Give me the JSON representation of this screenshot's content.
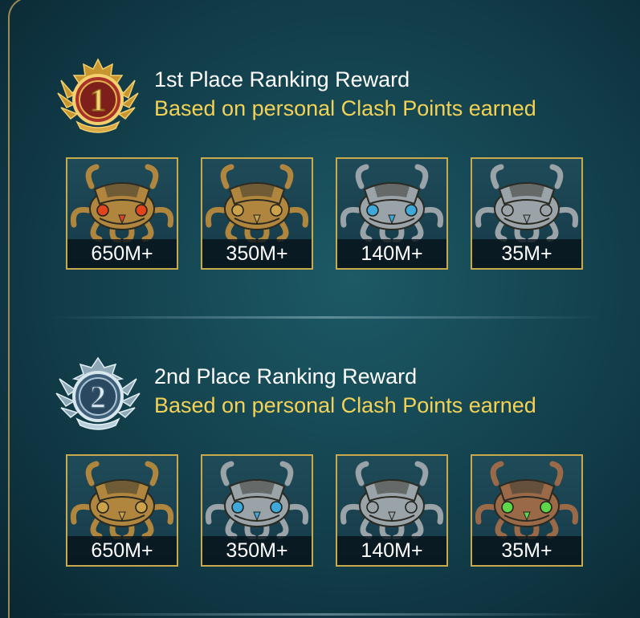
{
  "sections": [
    {
      "title": "1st Place Ranking Reward",
      "subtitle": "Based on personal Clash Points earned",
      "medal_icon": "gold-rank-1-medal-icon",
      "rewards": [
        {
          "label": "650M+",
          "chest_icon": "octopus-chest-icon",
          "tint": "#b0863e",
          "gem": "#e0451e"
        },
        {
          "label": "350M+",
          "chest_icon": "octopus-chest-icon",
          "tint": "#b0863e",
          "gem": "#c9a24a"
        },
        {
          "label": "140M+",
          "chest_icon": "octopus-chest-icon",
          "tint": "#9aa3a8",
          "gem": "#3fa8d8"
        },
        {
          "label": "35M+",
          "chest_icon": "octopus-chest-icon",
          "tint": "#9aa3a8",
          "gem": "#9aa3a8"
        }
      ]
    },
    {
      "title": "2nd Place Ranking Reward",
      "subtitle": "Based on personal Clash Points earned",
      "medal_icon": "silver-rank-2-medal-icon",
      "rewards": [
        {
          "label": "650M+",
          "chest_icon": "octopus-chest-icon",
          "tint": "#b0863e",
          "gem": "#c9a24a"
        },
        {
          "label": "350M+",
          "chest_icon": "octopus-chest-icon",
          "tint": "#9aa3a8",
          "gem": "#3fa8d8"
        },
        {
          "label": "140M+",
          "chest_icon": "octopus-chest-icon",
          "tint": "#9aa3a8",
          "gem": "#9aa3a8"
        },
        {
          "label": "35M+",
          "chest_icon": "octopus-chest-icon",
          "tint": "#9a6a48",
          "gem": "#5fd64a"
        }
      ]
    }
  ],
  "medals": {
    "first": {
      "numeral": "1",
      "color": "#d9aa45"
    },
    "second": {
      "numeral": "2",
      "color": "#b9cfdc"
    }
  },
  "colors": {
    "title": "#ffffff",
    "subtitle": "#f3d255",
    "card_border": "#c9a94d"
  }
}
